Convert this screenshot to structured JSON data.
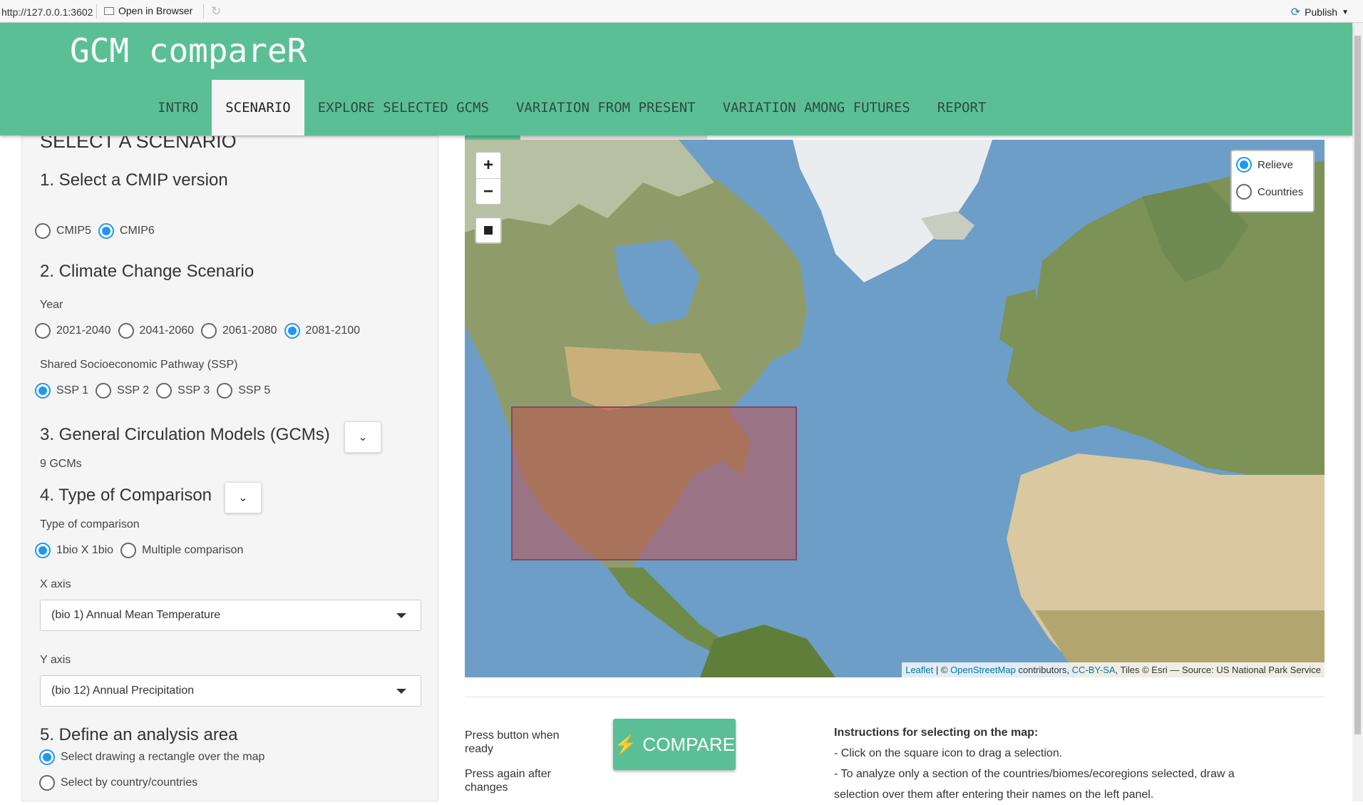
{
  "browser": {
    "url": "http://127.0.0.1:3602",
    "open_label": "Open in Browser",
    "publish_label": "Publish"
  },
  "app": {
    "title": "GCM compareR",
    "tabs": [
      {
        "label": "INTRO",
        "active": false
      },
      {
        "label": "SCENARIO",
        "active": true
      },
      {
        "label": "EXPLORE SELECTED GCMS",
        "active": false
      },
      {
        "label": "VARIATION FROM PRESENT",
        "active": false
      },
      {
        "label": "VARIATION AMONG FUTURES",
        "active": false
      },
      {
        "label": "REPORT",
        "active": false
      }
    ]
  },
  "sidebar": {
    "heading": "SELECT A SCENARIO",
    "s1_title": "1. Select a CMIP version",
    "cmip": {
      "options": [
        "CMIP5",
        "CMIP6"
      ],
      "selected": "CMIP6"
    },
    "s2_title": "2. Climate Change Scenario",
    "year_label": "Year",
    "years": {
      "options": [
        "2021-2040",
        "2041-2060",
        "2061-2080",
        "2081-2100"
      ],
      "selected": "2081-2100"
    },
    "ssp_label": "Shared Socioeconomic Pathway (SSP)",
    "ssp": {
      "options": [
        "SSP 1",
        "SSP 2",
        "SSP 3",
        "SSP 5"
      ],
      "selected": "SSP 1"
    },
    "s3_title": "3. General Circulation Models (GCMs)",
    "gcm_count": "9 GCMs",
    "s4_title": "4. Type of Comparison",
    "comparison_label": "Type of comparison",
    "comparison": {
      "options": [
        "1bio X 1bio",
        "Multiple comparison"
      ],
      "selected": "1bio X 1bio"
    },
    "x_axis_label": "X axis",
    "x_axis_value": "(bio 1) Annual Mean Temperature",
    "y_axis_label": "Y axis",
    "y_axis_value": "(bio 12) Annual Precipitation",
    "s5_title": "5. Define an analysis area",
    "area_options": [
      "Select drawing a rectangle over the map",
      "Select by country/countries"
    ],
    "area_selected": "Select drawing a rectangle over the map"
  },
  "map": {
    "layers": [
      {
        "label": "Relieve",
        "selected": true
      },
      {
        "label": "Countries",
        "selected": false
      }
    ],
    "zoom_in": "+",
    "zoom_out": "−",
    "attribution": {
      "leaflet": "Leaflet",
      "sep": " | © ",
      "osm": "OpenStreetMap",
      "contrib": " contributors, ",
      "license": "CC-BY-SA",
      "tiles": ", Tiles © Esri — Source: US National Park Service"
    },
    "selection_color": "#c0504d"
  },
  "bottom": {
    "press1": "Press button when ready",
    "press2": "Press again after changes",
    "compare_label": "COMPARE",
    "instructions_title": "Instructions for selecting on the map:",
    "instructions": [
      "- Click on the square icon to drag a selection.",
      "- To analyze only a section of the countries/biomes/ecoregions selected, draw a",
      "selection over them after entering their names on the left panel."
    ]
  },
  "colors": {
    "accent": "#5bbf96",
    "radio": "#2196f3"
  }
}
